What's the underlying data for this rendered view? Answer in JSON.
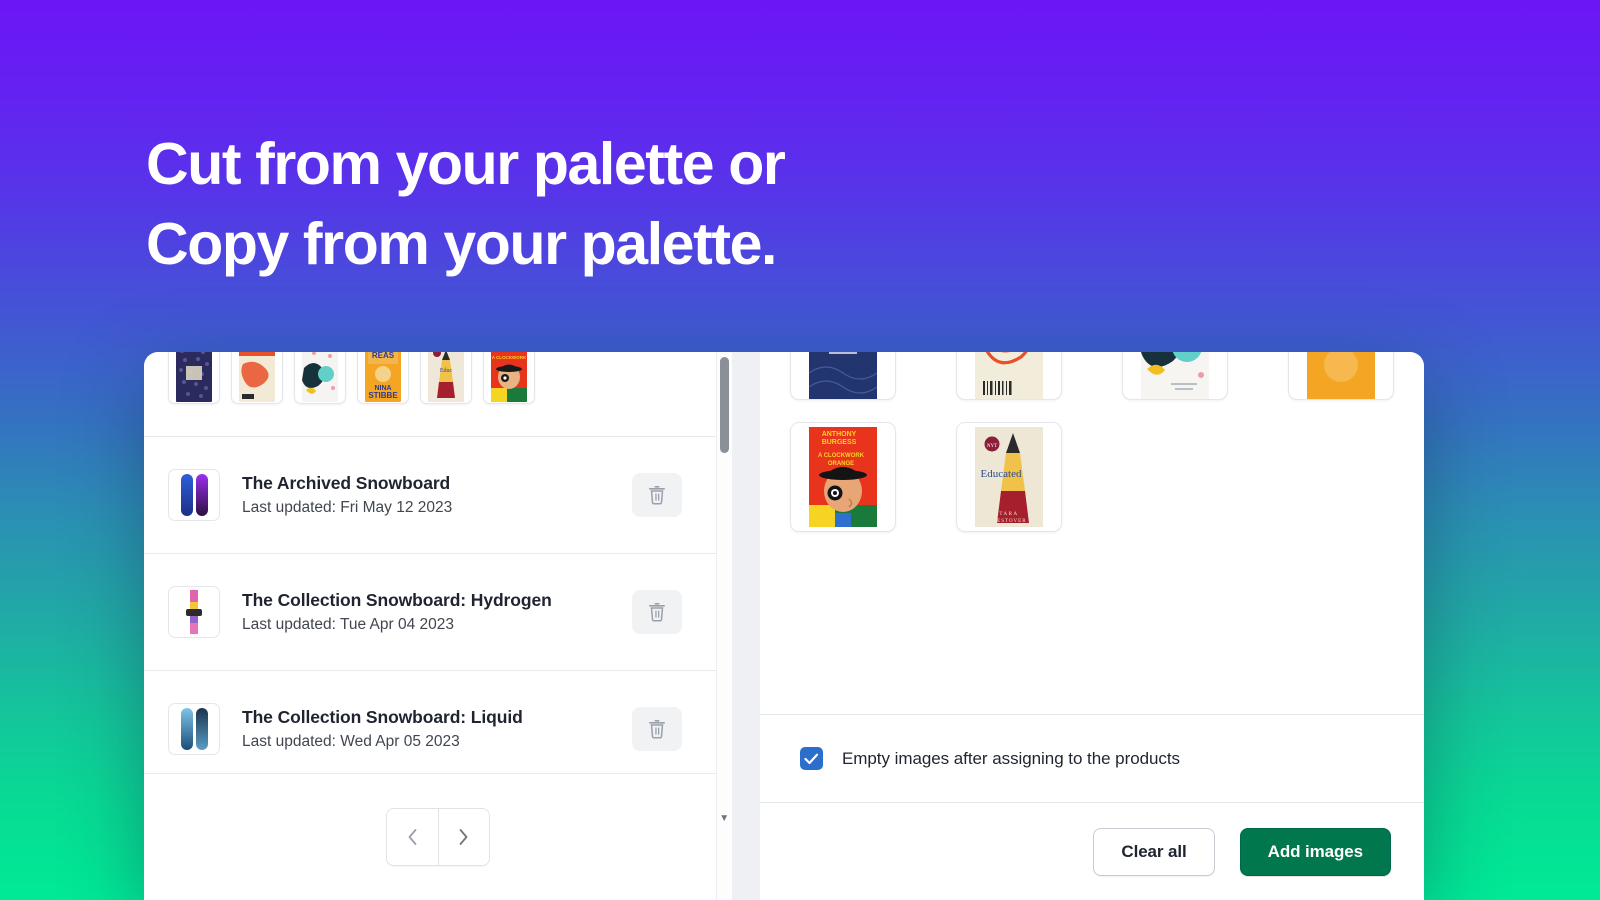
{
  "hero": {
    "line1": "Cut from your palette or",
    "line2": "Copy from your palette."
  },
  "left_panel": {
    "thumbnail_strip": [
      {
        "name": "navy-patterned-cover"
      },
      {
        "name": "orange-goldfinch-cover"
      },
      {
        "name": "teal-illustrated-cover"
      },
      {
        "name": "reasons-nina-stibbe-cover"
      },
      {
        "name": "educated-cover"
      },
      {
        "name": "clockwork-orange-cover"
      }
    ],
    "products": [
      {
        "title": "The Archived Snowboard",
        "subtitle": "Last updated: Fri May 12 2023",
        "thumb": "snowboard-blue-purple"
      },
      {
        "title": "The Collection Snowboard: Hydrogen",
        "subtitle": "Last updated: Tue Apr 04 2023",
        "thumb": "snowboard-floral"
      },
      {
        "title": "The Collection Snowboard: Liquid",
        "subtitle": "Last updated: Wed Apr 05 2023",
        "thumb": "snowboard-liquid-blue"
      }
    ],
    "delete_icon": "trash-icon",
    "pagination": {
      "previous_icon": "chevron-left-icon",
      "next_icon": "chevron-right-icon"
    },
    "scrollbar": {
      "down_arrow_icon": "caret-down-icon"
    }
  },
  "right_panel": {
    "covers_row1": [
      {
        "name": "navy-patterned-cover"
      },
      {
        "name": "orange-goldfinch-cover"
      },
      {
        "name": "teal-illustrated-cover"
      },
      {
        "name": "reasons-nina-stibbe-cover"
      }
    ],
    "covers_row2": [
      {
        "name": "clockwork-orange-cover"
      },
      {
        "name": "educated-cover"
      }
    ],
    "cover_text": {
      "stibbe_top": "NINA",
      "stibbe_bottom": "STIBBE",
      "burgess_author": "ANTHONY BURGESS",
      "burgess_title": "A CLOCKWORK ORANGE",
      "educated_title": "Educated",
      "educated_author": "TARA WESTOVER"
    },
    "checkbox": {
      "label": "Empty images after assigning to the products",
      "checked": true,
      "icon": "check-icon"
    },
    "actions": {
      "clear_all_label": "Clear all",
      "add_images_label": "Add images"
    }
  },
  "colors": {
    "gradient_top": "#6b16f5",
    "gradient_bottom": "#00ea96",
    "primary_button": "#00774c",
    "checkbox_blue": "#2c6ecb"
  }
}
